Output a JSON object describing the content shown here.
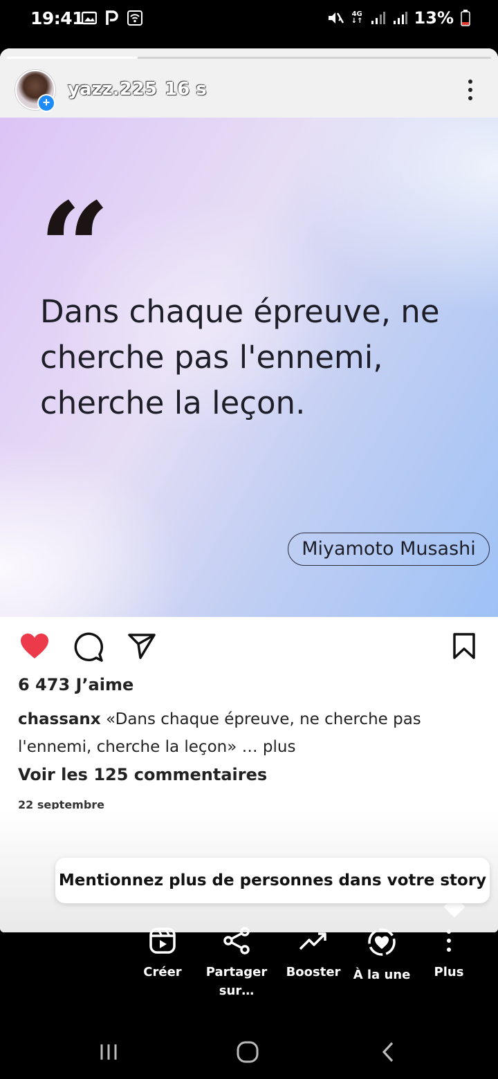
{
  "status_bar": {
    "time": "19:41",
    "network": "4G",
    "battery": "13%"
  },
  "story": {
    "username": "yazz.225",
    "time_ago": "16 s",
    "progress_fraction": 0.27
  },
  "quote_card": {
    "quote": "Dans chaque épreuve, ne cherche pas l'ennemi, cherche la leçon.",
    "author": "Miyamoto Musashi"
  },
  "post": {
    "likes": "6 473 J’aime",
    "caption_user": "chassanx",
    "caption_text": "«Dans chaque épreuve, ne cherche pas l'ennemi, cherche la leçon» …",
    "caption_more": "plus",
    "comments_link": "Voir les 125 commentaires",
    "date": "22 septembre",
    "liked": true
  },
  "tooltip": {
    "text": "Mentionnez plus de personnes dans votre story"
  },
  "bottom_actions": [
    {
      "label": "Créer",
      "icon": "reels-icon"
    },
    {
      "label": "Partager sur…",
      "icon": "share-icon"
    },
    {
      "label": "Booster",
      "icon": "trend-arrow-icon"
    },
    {
      "label": "À la une",
      "icon": "highlight-heart-icon"
    },
    {
      "label": "Plus",
      "icon": "vertical-dots-icon"
    }
  ],
  "colors": {
    "like_red": "#ed3a4b",
    "plus_badge_blue": "#1f8bf7",
    "gradient_purple": "#dcc4f6",
    "gradient_blue": "#9ec1f5"
  }
}
